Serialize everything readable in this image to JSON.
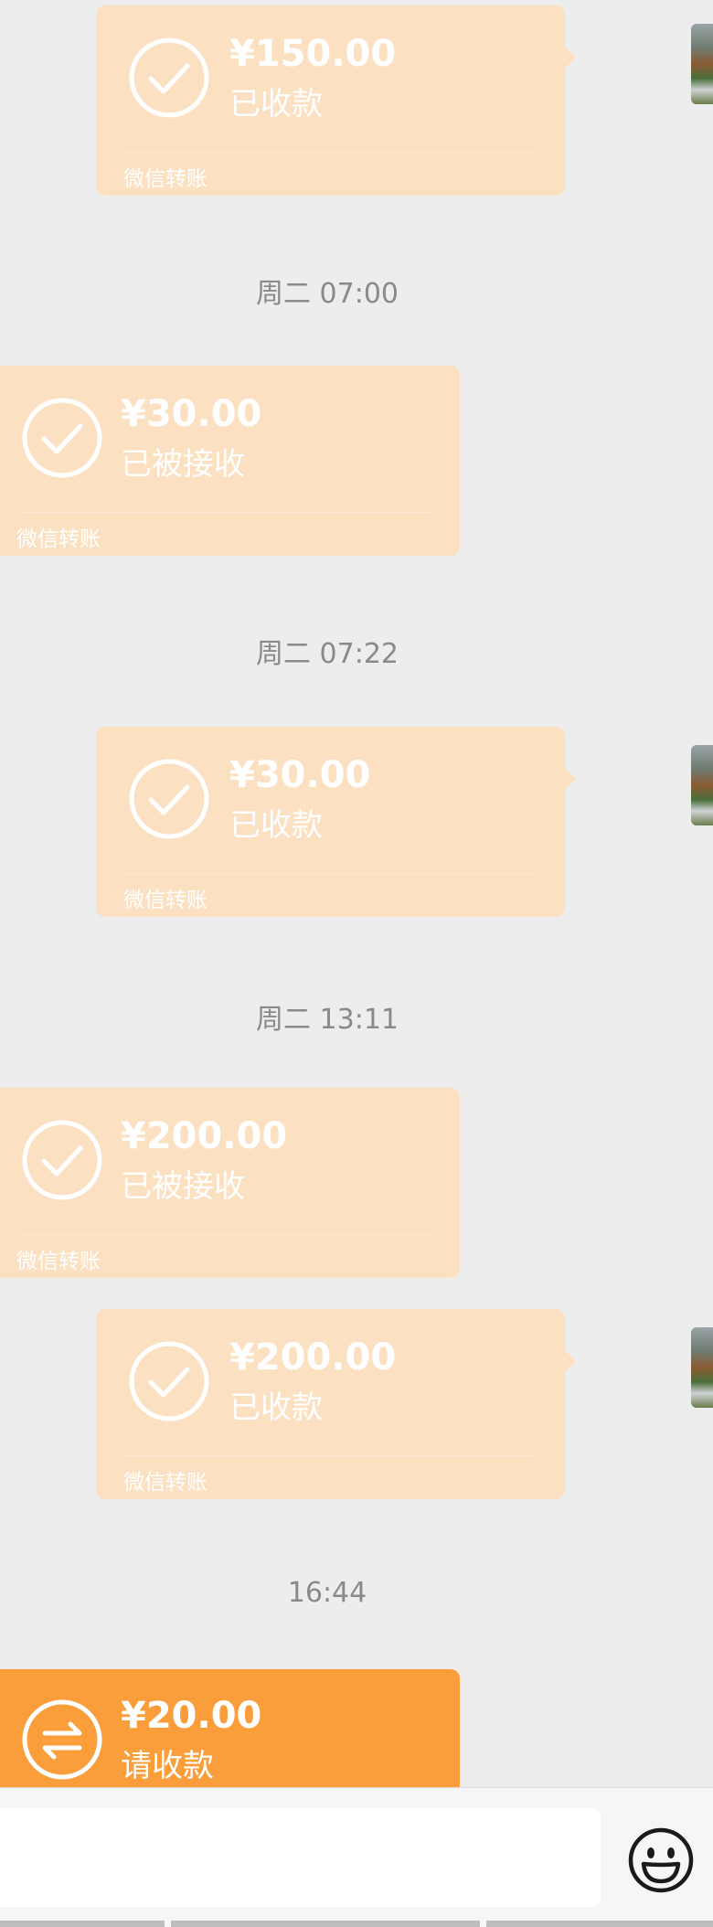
{
  "colors": {
    "background": "#ededed",
    "transfer_done": "#fbe1c2",
    "transfer_pending": "#fa9d3b",
    "text_on_bubble": "#ffffff",
    "timestamp": "#8a8a8a"
  },
  "messages": [
    {
      "id": "m1",
      "side": "right",
      "state": "done",
      "icon": "check-circle-icon",
      "amount": "¥150.00",
      "status": "已收款",
      "footer": "微信转账"
    },
    {
      "id": "t1",
      "timestamp": "周二 07:00"
    },
    {
      "id": "m2",
      "side": "left",
      "state": "done",
      "icon": "check-circle-icon",
      "amount": "¥30.00",
      "status": "已被接收",
      "footer": "微信转账"
    },
    {
      "id": "t2",
      "timestamp": "周二 07:22"
    },
    {
      "id": "m3",
      "side": "right",
      "state": "done",
      "icon": "check-circle-icon",
      "amount": "¥30.00",
      "status": "已收款",
      "footer": "微信转账"
    },
    {
      "id": "t3",
      "timestamp": "周二 13:11"
    },
    {
      "id": "m4",
      "side": "left",
      "state": "done",
      "icon": "check-circle-icon",
      "amount": "¥200.00",
      "status": "已被接收",
      "footer": "微信转账"
    },
    {
      "id": "m5",
      "side": "right",
      "state": "done",
      "icon": "check-circle-icon",
      "amount": "¥200.00",
      "status": "已收款",
      "footer": "微信转账"
    },
    {
      "id": "t4",
      "timestamp": "16:44"
    },
    {
      "id": "m6",
      "side": "left",
      "state": "pending",
      "icon": "transfer-arrows-icon",
      "amount": "¥20.00",
      "status": "请收款",
      "footer": ""
    }
  ],
  "input_bar": {
    "emoji_icon": "emoji-icon"
  }
}
